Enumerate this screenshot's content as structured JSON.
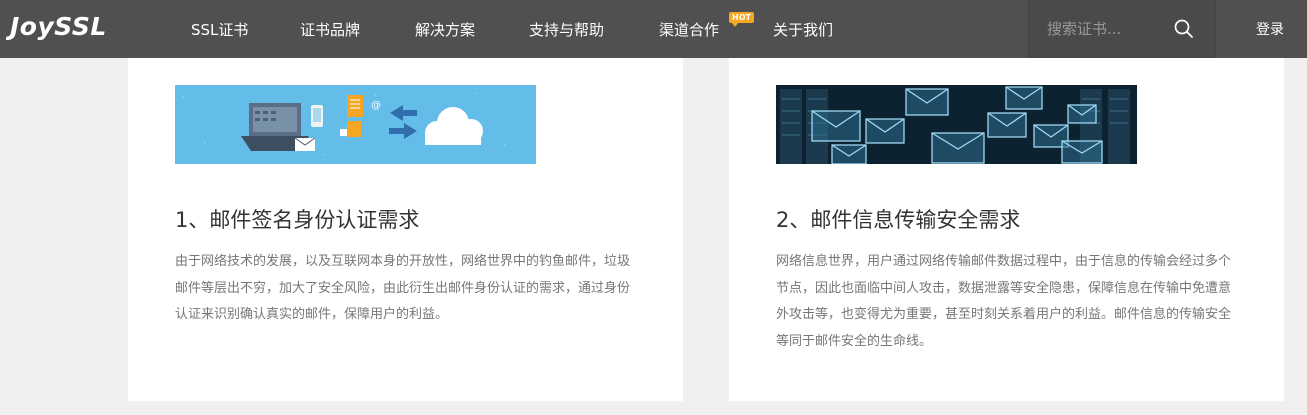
{
  "header": {
    "logo_text": "JoySSL",
    "nav": [
      "SSL证书",
      "证书品牌",
      "解决方案",
      "支持与帮助",
      "渠道合作",
      "关于我们"
    ],
    "hot_badge": "HOT",
    "search_placeholder": "搜索证书...",
    "login_label": "登录"
  },
  "cards": [
    {
      "title": "1、邮件签名身份认证需求",
      "description": "由于网络技术的发展，以及互联网本身的开放性，网络世界中的钓鱼邮件，垃圾邮件等层出不穷，加大了安全风险，由此衍生出邮件身份认证的需求，通过身份认证来识别确认真实的邮件，保障用户的利益。"
    },
    {
      "title": "2、邮件信息传输安全需求",
      "description": "网络信息世界，用户通过网络传输邮件数据过程中，由于信息的传输会经过多个节点，因此也面临中间人攻击，数据泄露等安全隐患，保障信息在传输中免遭意外攻击等，也变得尤为重要，甚至时刻关系着用户的利益。邮件信息的传输安全等同于邮件安全的生命线。"
    }
  ],
  "colors": {
    "header_bg": "#505050",
    "page_bg": "#f0f0f0",
    "hot_badge": "#f5a623",
    "banner1_bg": "#64bde9",
    "banner2_bg": "#0d2230"
  }
}
